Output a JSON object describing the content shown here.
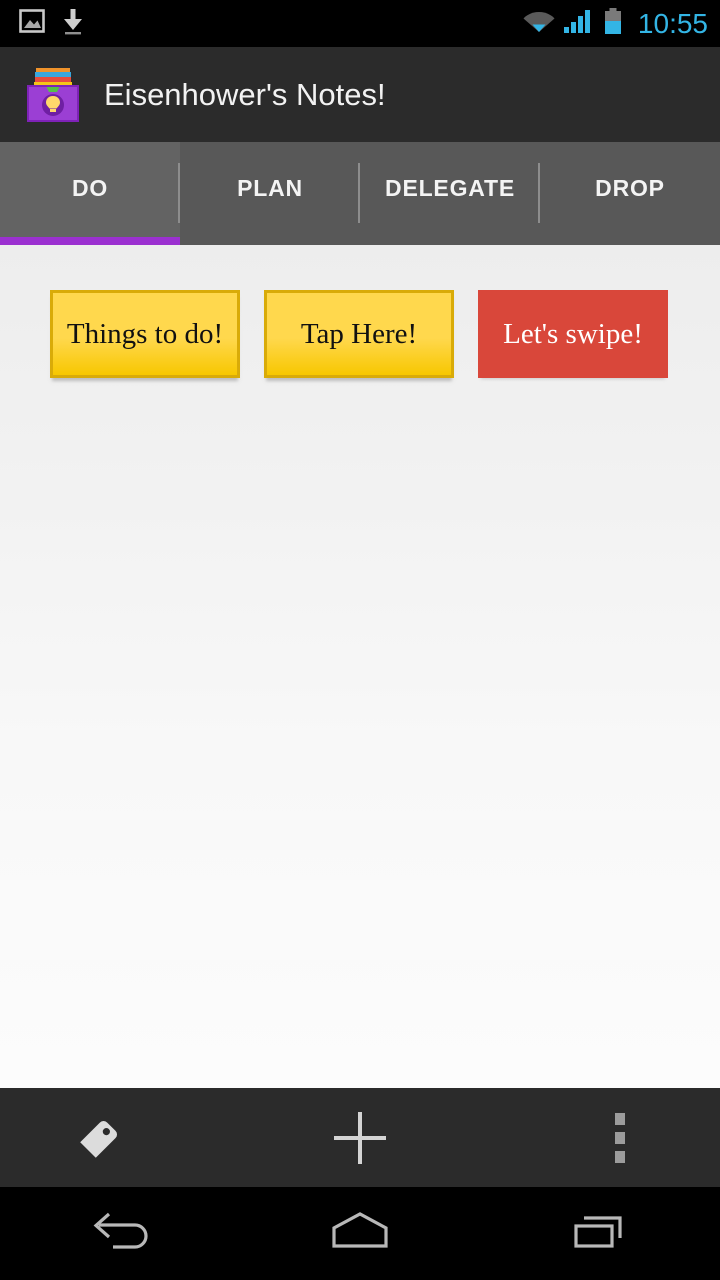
{
  "statusbar": {
    "time": "10:55",
    "left_icons": [
      {
        "name": "image-icon",
        "label": "screenshot"
      },
      {
        "name": "download-icon",
        "label": "download"
      }
    ],
    "right_icons": [
      {
        "name": "wifi-icon",
        "label": "wifi"
      },
      {
        "name": "cellular-signal-icon",
        "label": "signal"
      },
      {
        "name": "battery-icon",
        "label": "battery"
      }
    ],
    "colors": {
      "time": "#33b5e5",
      "background": "#000000"
    }
  },
  "titlebar": {
    "title": "Eisenhower's Notes!",
    "icon_name": "app-logo-card-box-icon",
    "background": "#2b2b2b"
  },
  "tabs": {
    "selected_index": 0,
    "indicator_color": "#9b30d0",
    "items": [
      {
        "label": "DO"
      },
      {
        "label": "PLAN"
      },
      {
        "label": "DELEGATE"
      },
      {
        "label": "DROP"
      }
    ]
  },
  "notes": [
    {
      "text": "Things to do!",
      "color": "yellow",
      "fill": "#ffd84d",
      "border": "#d9ab08",
      "text_color": "#111111"
    },
    {
      "text": "Tap Here!",
      "color": "yellow",
      "fill": "#ffd84d",
      "border": "#d9ab08",
      "text_color": "#111111"
    },
    {
      "text": "Let's swipe!",
      "color": "red",
      "fill": "#d9473a",
      "border": "none",
      "text_color": "#ffffff"
    }
  ],
  "actionbar": {
    "background": "#2b2b2b",
    "tag_button_label": "Tag",
    "add_button_label": "Add note",
    "overflow_button_label": "More options"
  },
  "navbar": {
    "background": "#000000",
    "back_label": "Back",
    "home_label": "Home",
    "recents_label": "Recent apps"
  }
}
